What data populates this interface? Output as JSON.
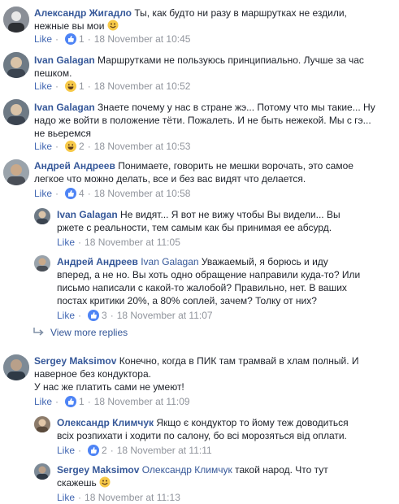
{
  "comments": [
    {
      "author": "Александр Жигадло",
      "lines": [
        "Ты, как будто ни разу в маршрутках не ездили,",
        "нежные вы мои"
      ],
      "inline_emoji": "smile-emoji",
      "like_label": "Like",
      "reaction": "like",
      "count": "1",
      "time": "18 November at 10:45"
    },
    {
      "author": "Ivan Galagan",
      "lines": [
        "Маршрутками не пользуюсь принципиально. Лучше за час",
        "пешком."
      ],
      "like_label": "Like",
      "reaction": "haha",
      "count": "1",
      "time": "18 November at 10:52"
    },
    {
      "author": "Ivan Galagan",
      "lines": [
        "Знаете почему у нас в стране жэ... Потому что мы такие... Ну",
        "надо же войти в положение тёти. Пожалеть. И не быть нежекой. Мы с гэ...",
        "не вьеремся"
      ],
      "like_label": "Like",
      "reaction": "haha",
      "count": "2",
      "time": "18 November at 10:53"
    },
    {
      "author": "Андрей Андреев",
      "lines": [
        "Понимаете, говорить не мешки ворочать, это самое",
        "легкое что можно делать, все и без вас видят что делается."
      ],
      "like_label": "Like",
      "reaction": "like",
      "count": "4",
      "time": "18 November at 10:58"
    },
    {
      "author": "Ivan Galagan",
      "lines": [
        "Не видят... Я вот не вижу чтобы Вы видели... Вы",
        "ржете с реальности, тем самым как бы принимая ее абсурд."
      ],
      "like_label": "Like",
      "time": "18 November at 11:05"
    },
    {
      "author": "Андрей Андреев",
      "tag": "Ivan Galagan",
      "lines": [
        "Уважаемый, я борюсь и иду",
        "вперед, а не но. Вы хоть одно обращение направили куда-то? Или",
        "письмо написали с какой-то жалобой? Правильно, нет. В ваших",
        "постах критики 20%, а 80% соплей, зачем? Толку от них?"
      ],
      "like_label": "Like",
      "reaction": "like",
      "count": "3",
      "time": "18 November at 11:07"
    },
    {
      "author": "Sergey Maksimov",
      "lines": [
        "Конечно, когда в ПИК там трамвай в хлам полный. И",
        "наверное без кондуктора.",
        "У нас же платить сами не умеют!"
      ],
      "like_label": "Like",
      "reaction": "like",
      "count": "1",
      "time": "18 November at 11:09"
    },
    {
      "author": "Олександр Климчук",
      "lines": [
        "Якщо є кондуктор то йому теж доводиться",
        "всіх розпихати і ходити по салону, бо всі морозяться від оплати."
      ],
      "like_label": "Like",
      "reaction": "like",
      "count": "2",
      "time": "18 November at 11:11"
    },
    {
      "author": "Sergey Maksimov",
      "tag": "Олександр Климчук",
      "lines": [
        "такой народ. Что тут",
        "скажешь"
      ],
      "inline_emoji": "smile-emoji",
      "like_label": "Like",
      "time": "18 November at 11:13"
    }
  ],
  "view_more": "View more replies",
  "separator": "·",
  "colors": {
    "link": "#365899",
    "meta": "#90949c",
    "like_blue": "#4e84f5",
    "haha_yellow": "#f7c948"
  }
}
